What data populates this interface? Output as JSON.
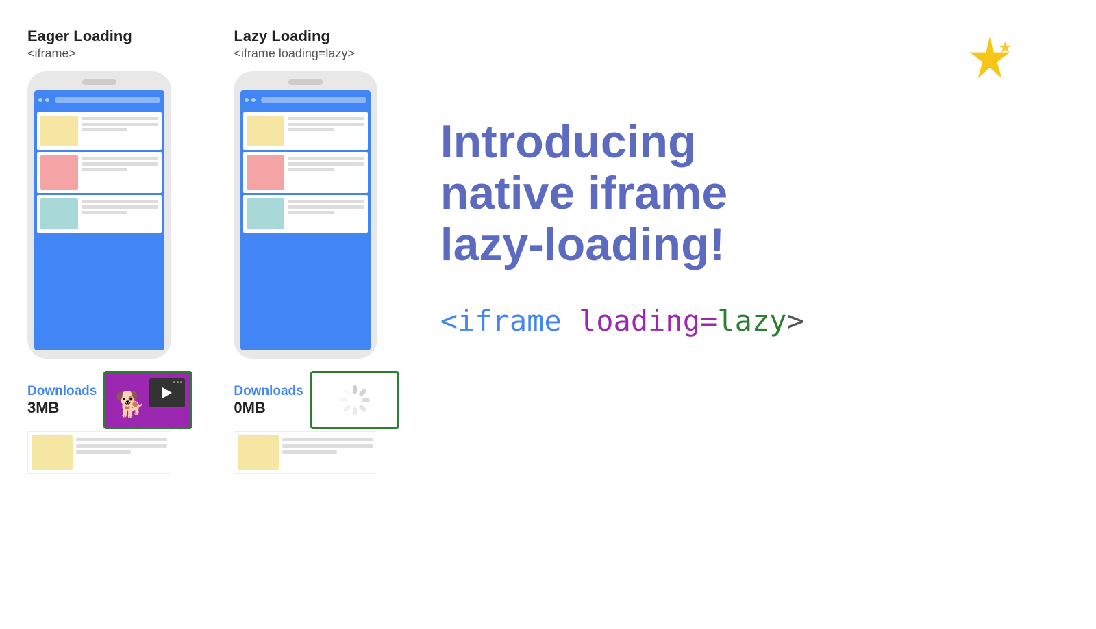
{
  "eager": {
    "title": "Eager Loading",
    "subtitle": "<iframe>",
    "downloads_label": "Downloads",
    "downloads_size": "3MB"
  },
  "lazy": {
    "title": "Lazy Loading",
    "subtitle": "<iframe loading=lazy>",
    "downloads_label": "Downloads",
    "downloads_size": "0MB"
  },
  "introducing": {
    "line1": "Introducing",
    "line2": "native iframe",
    "line3": "lazy-loading!"
  },
  "code_tag": {
    "prefix": "<iframe ",
    "attr_name": "loading=",
    "attr_value": "lazy",
    "suffix": ">"
  }
}
